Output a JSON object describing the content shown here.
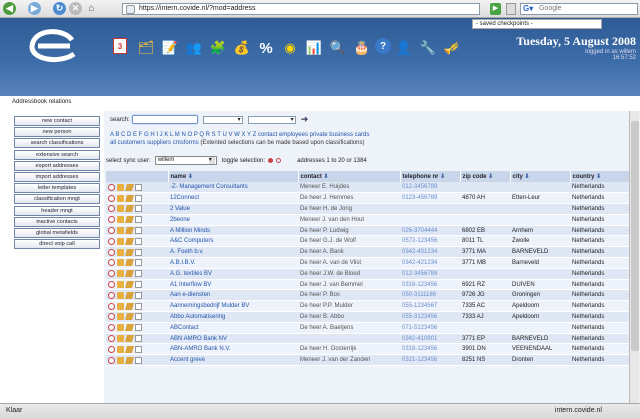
{
  "browser": {
    "url": "https://intern.covide.nl/?mod=address",
    "search_placeholder": "Google",
    "saved_checkpoints": "- saved checkpoints -"
  },
  "header": {
    "date": "Tuesday, 5 August 2008",
    "logged_in": "logged in as  willem",
    "time": "16:57:52",
    "icons": [
      "calendar-icon",
      "folder-icon",
      "notes-icon",
      "users-icon",
      "tools-icon",
      "money-icon",
      "percent-icon",
      "clock-icon",
      "chart-icon",
      "magnifier-icon",
      "birthday-icon",
      "help-icon",
      "profile-icon",
      "wrench-icon",
      "trumpet-icon"
    ]
  },
  "breadcrumb": "Addressbook  relations",
  "sidebar": [
    "new contact",
    "new person",
    "search classifications",
    "extensive search",
    "export addresses",
    "import addresses",
    "letter templates",
    "classification mngt",
    "header mngt",
    "inactive contacts",
    "global metafields",
    "direct voip call"
  ],
  "search": {
    "label": "search:"
  },
  "alphabet": "A B C D E F G H I J K L M N O P Q R S T U V W X Y Z",
  "alpha_links": "contact employees private business cards",
  "filters": {
    "links": "all  customers  suppliers  cmsforms",
    "note": "(Extented selections can be made based upon classifications)"
  },
  "sync": {
    "label": "select sync user:",
    "user": "willem",
    "toggle": "toggle selection:",
    "range": "addresses 1 to 20 or 1384"
  },
  "table": {
    "headers": [
      "name",
      "contact",
      "telephone nr",
      "zip code",
      "city",
      "country"
    ],
    "rows": [
      {
        "name": "-Z- Management Consultants",
        "contact": "Meneer E. Huijdes",
        "tel": "012-3456789",
        "zip": "",
        "city": "",
        "country": "Netherlands"
      },
      {
        "name": "12Connect",
        "contact": "De heer J. Hemmes",
        "tel": "0123-456789",
        "zip": "4870 AH",
        "city": "Etten-Leur",
        "country": "Netherlands"
      },
      {
        "name": "2 Value",
        "contact": "De heer H. de Jong",
        "tel": "",
        "zip": "",
        "city": "",
        "country": "Netherlands"
      },
      {
        "name": "2beone",
        "contact": "Meneer J. van den Hout",
        "tel": "",
        "zip": "",
        "city": "",
        "country": "Netherlands"
      },
      {
        "name": "A Million Minds",
        "contact": "De heer P. Ludwig",
        "tel": "026-3704444",
        "zip": "6802 EB",
        "city": "Arnhem",
        "country": "Netherlands"
      },
      {
        "name": "A&C Computers",
        "contact": "De heer G.J. de Wolf",
        "tel": "0572-123456",
        "zip": "8011 TL",
        "city": "Zwolle",
        "country": "Netherlands"
      },
      {
        "name": "A. Foeth b.v.",
        "contact": "De heer A. Bank",
        "tel": "0342-401234",
        "zip": "3771 MA",
        "city": "BARNEVELD",
        "country": "Netherlands"
      },
      {
        "name": "A.B.I.B.V.",
        "contact": "De heer A. van de Vlist",
        "tel": "0342-421234",
        "zip": "3771 MB",
        "city": "Barneveld",
        "country": "Netherlands"
      },
      {
        "name": "A.G. textiles BV",
        "contact": "De heer J.W. de Bloed",
        "tel": "012-3456789",
        "zip": "",
        "city": "",
        "country": "Netherlands"
      },
      {
        "name": "A1 Interflow BV",
        "contact": "De heer J. van Bemmel",
        "tel": "0316-123456",
        "zip": "6921 RZ",
        "city": "DUIVEN",
        "country": "Netherlands"
      },
      {
        "name": "Aan e-diensten",
        "contact": "De heer P. Bos",
        "tel": "050-3111186",
        "zip": "9726 JG",
        "city": "Groningen",
        "country": "Netherlands"
      },
      {
        "name": "Aannemingsbedrijf Mulder BV",
        "contact": "De heer P.P. Mulder",
        "tel": "055-1234567",
        "zip": "7335 AC",
        "city": "Apeldoorn",
        "country": "Netherlands"
      },
      {
        "name": "Abbo Automatisering",
        "contact": "De heer B. Abbo",
        "tel": "055-3123456",
        "zip": "7333 AJ",
        "city": "Apeldoorn",
        "country": "Netherlands"
      },
      {
        "name": "ABContact",
        "contact": "De heer A. Baetjens",
        "tel": "071-5123456",
        "zip": "",
        "city": "",
        "country": "Netherlands"
      },
      {
        "name": "ABN AMRO Bank NV",
        "contact": "",
        "tel": "0342-410901",
        "zip": "3771 EP",
        "city": "BARNEVELD",
        "country": "Netherlands"
      },
      {
        "name": "ABN-AMRO Bank N.V.",
        "contact": "De heer H. Oosterrijk",
        "tel": "0318-123456",
        "zip": "3901 DN",
        "city": "VEENENDAAL",
        "country": "Netherlands"
      },
      {
        "name": "Accent greve",
        "contact": "Meneer J. van der Zanden",
        "tel": "0321-123456",
        "zip": "8251 NS",
        "city": "Dronten",
        "country": "Netherlands"
      }
    ]
  },
  "status": {
    "left": "Klaar",
    "right": "intern.covide.nl"
  }
}
